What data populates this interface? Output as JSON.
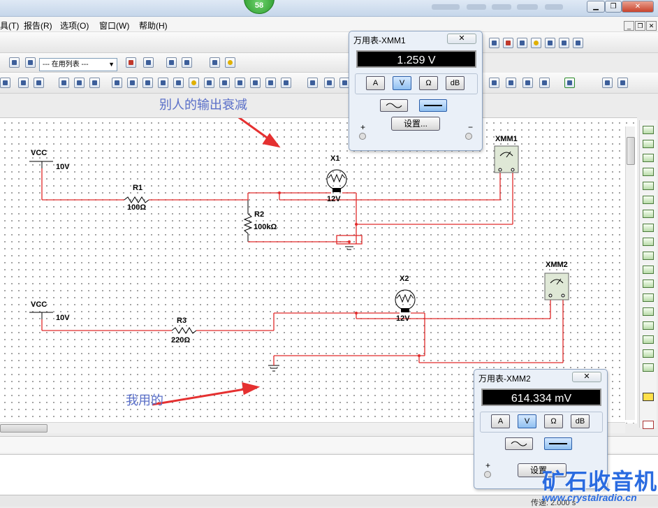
{
  "titlebar": {
    "badge": "58"
  },
  "menu": {
    "items": [
      "具(T)",
      "报告(R)",
      "选项(O)",
      "窗口(W)",
      "帮助(H)"
    ]
  },
  "toolbar": {
    "inuse_list": "--- 在用列表 ---"
  },
  "schematic": {
    "circuit1": {
      "vcc_label": "VCC",
      "vcc_value": "10V",
      "r1_ref": "R1",
      "r1_value": "100Ω",
      "r2_ref": "R2",
      "r2_value": "100kΩ",
      "lamp_ref": "X1",
      "lamp_value": "12V",
      "meter_ref": "XMM1"
    },
    "circuit2": {
      "vcc_label": "VCC",
      "vcc_value": "10V",
      "r3_ref": "R3",
      "r3_value": "220Ω",
      "lamp_ref": "X2",
      "lamp_value": "12V",
      "meter_ref": "XMM2"
    },
    "annotations": {
      "top": "别人的输出衰减",
      "bottom": "我用的"
    }
  },
  "meter1": {
    "title": "万用表-XMM1",
    "reading": "1.259 V",
    "buttons": [
      "A",
      "V",
      "Ω",
      "dB"
    ],
    "active": "V",
    "settings": "设置...",
    "plus": "+",
    "minus": "−"
  },
  "meter2": {
    "title": "万用表-XMM2",
    "reading": "614.334 mV",
    "buttons": [
      "A",
      "V",
      "Ω",
      "dB"
    ],
    "active": "V",
    "settings": "设置...",
    "plus": "+"
  },
  "status": {
    "transient": "传递: 2.000 s"
  },
  "watermark": {
    "title": "矿石收音机",
    "url": "www.crystalradio.cn"
  },
  "colors": {
    "wire": "#e02a2a",
    "annotation": "#5a6fc8",
    "watermark": "#2a6be0"
  }
}
